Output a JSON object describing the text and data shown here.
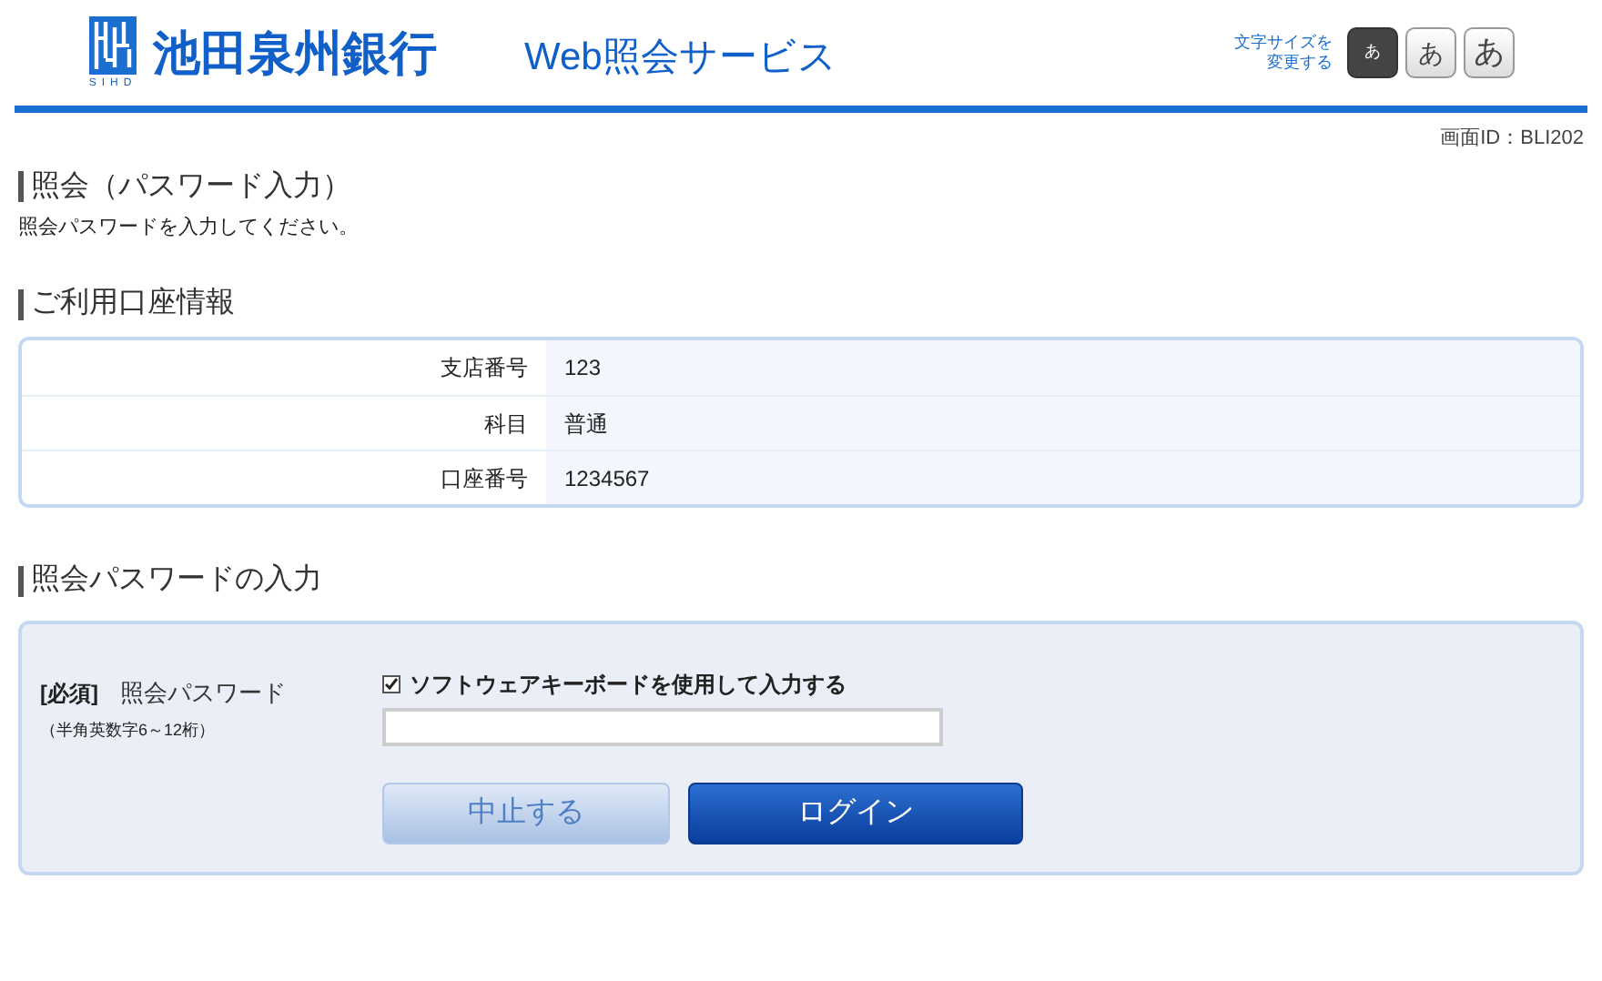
{
  "header": {
    "bank_name": "池田泉州銀行",
    "logo_caption": "SIHD",
    "service_title": "Web照会サービス",
    "font_size_label": "文字サイズを変更する",
    "font_sizes": [
      {
        "label": "あ",
        "kind": "small",
        "selected": true
      },
      {
        "label": "あ",
        "kind": "medium",
        "selected": false
      },
      {
        "label": "あ",
        "kind": "large",
        "selected": false
      }
    ]
  },
  "screen_id": "画面ID：BLI202",
  "page_heading": "照会（パスワード入力）",
  "instruction": "照会パスワードを入力してください。",
  "account_section": {
    "heading": "ご利用口座情報",
    "rows": [
      {
        "label": "支店番号",
        "value": "123"
      },
      {
        "label": "科目",
        "value": "普通"
      },
      {
        "label": "口座番号",
        "value": "1234567"
      }
    ]
  },
  "password_section": {
    "heading": "照会パスワードの入力",
    "required_tag": "[必須]",
    "field_label": "照会パスワード",
    "hint": "（半角英数字6～12桁）",
    "software_keyboard": {
      "label": "ソフトウェアキーボードを使用して入力する",
      "checked": true
    },
    "buttons": [
      {
        "label": "中止する",
        "kind": "secondary"
      },
      {
        "label": "ログイン",
        "kind": "primary"
      }
    ]
  }
}
